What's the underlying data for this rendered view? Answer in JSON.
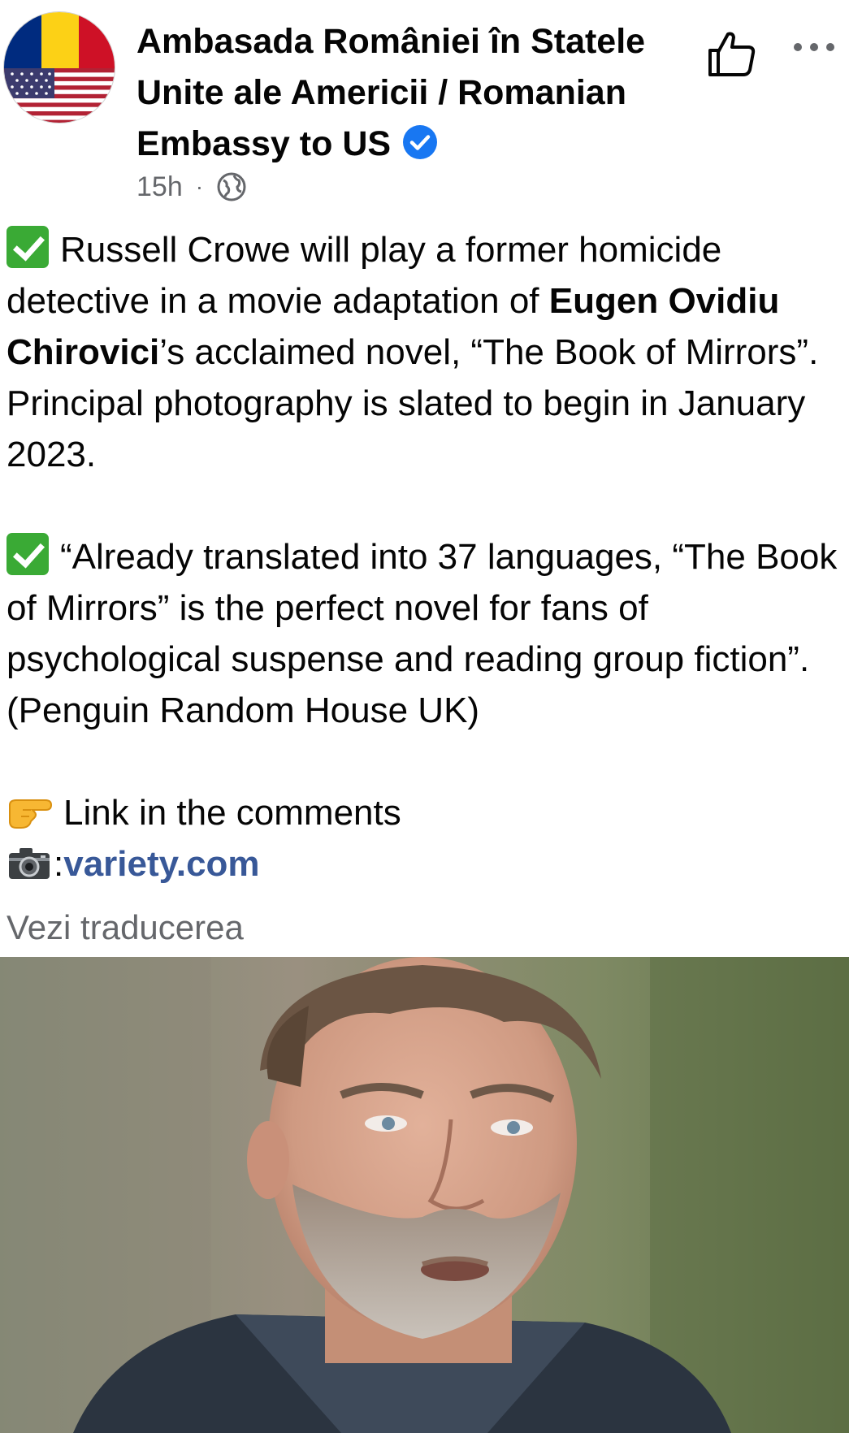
{
  "post": {
    "author": {
      "name": "Ambasada României în Statele Unite ale Americii / Romanian Embassy to US",
      "avatar_icon": "flags-avatar-icon",
      "verified_icon": "verified-badge-icon",
      "verified_color": "#1877f2"
    },
    "timestamp": "15h",
    "separator": "·",
    "privacy_icon": "globe-icon",
    "actions": {
      "like_icon": "thumbs-up-icon",
      "more_icon": "more-options-icon"
    },
    "paragraph1": {
      "part1": "Russell Crowe will play a former homicide detective in a movie adaptation of ",
      "author_bold": "Eugen Ovidiu Chirovici",
      "part2": "’s acclaimed novel, “The Book of Mirrors”.  Principal photography is slated to begin in January 2023."
    },
    "paragraph2": {
      "text": "“Already translated into 37 languages, “The Book of Mirrors” is the perfect novel for fans of psychological suspense and reading group fiction”. (Penguin Random House UK)"
    },
    "link_line": "Link in the comments",
    "source_prefix": ":",
    "source_link": "variety.com",
    "see_translation": "Vezi traducerea",
    "photo_alt_icon": "photo-of-man"
  }
}
